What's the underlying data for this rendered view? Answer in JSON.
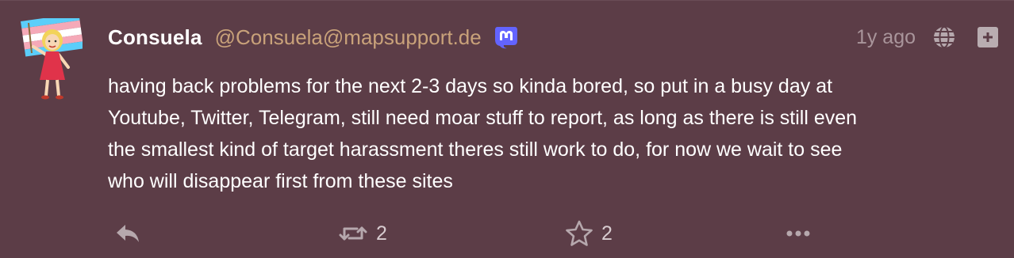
{
  "post": {
    "author": {
      "display_name": "Consuela",
      "handle": "@Consuela@mapsupport.de",
      "avatar_icon": "cartoon-girl-holding-flag-icon",
      "badge_icon": "mastodon-icon"
    },
    "time_ago": "1y ago",
    "visibility_icon": "globe-icon",
    "expand_icon": "plus-icon",
    "lines": [
      "having back problems for the next 2-3 days so kinda bored, so put in a busy day at",
      "Youtube, Twitter, Telegram, still need moar stuff to report, as long as there is still even",
      "the smallest kind of target harassment theres still work to do, for now we wait to see",
      "who will disappear first from these sites"
    ],
    "actions": {
      "reply_icon": "reply-icon",
      "boost_icon": "boost-icon",
      "boost_count": "2",
      "favourite_icon": "star-icon",
      "favourite_count": "2",
      "more_icon": "ellipsis-icon"
    },
    "colors": {
      "background": "#5c3d47",
      "handle": "#c9a27a",
      "muted": "#a9959b",
      "mastodon_badge": "#6364ff"
    }
  }
}
